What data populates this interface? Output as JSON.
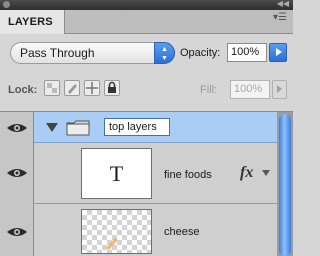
{
  "panel": {
    "tab_label": "LAYERS",
    "menu_icon": "panel-menu-icon"
  },
  "blend": {
    "mode": "Pass Through",
    "opacity_label": "Opacity:",
    "opacity_value": "100%"
  },
  "lock": {
    "label": "Lock:",
    "fill_label": "Fill:",
    "fill_value": "100%"
  },
  "layers": [
    {
      "type": "group",
      "name": "top layers",
      "visible": true,
      "expanded": true,
      "editing_name": true
    },
    {
      "type": "text",
      "name": "fine foods",
      "visible": true,
      "thumb_glyph": "T",
      "fx": "fx"
    },
    {
      "type": "pixel",
      "name": "cheese",
      "visible": true
    }
  ],
  "colors": {
    "selected_row": "#a9cdf4",
    "accent": "#2c6fd2"
  }
}
